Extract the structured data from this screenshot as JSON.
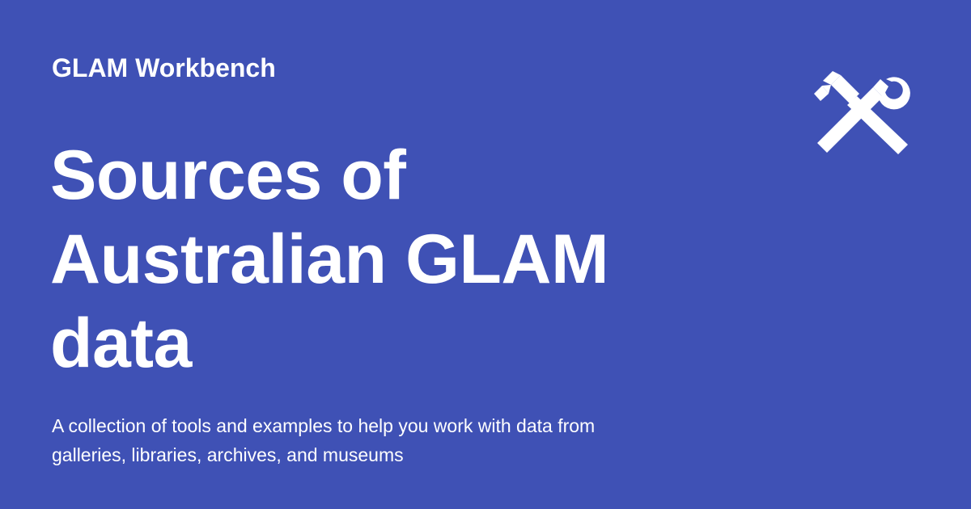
{
  "brand": {
    "site_name": "GLAM Workbench",
    "logo_icon": "hammer-wrench-icon",
    "background_color": "#3f51b5",
    "text_color": "#ffffff"
  },
  "hero": {
    "title_lines": [
      "Sources of",
      "Australian GLAM",
      "data"
    ],
    "description_lines": [
      "A collection of tools and examples to help you work with data from",
      "galleries, libraries, archives, and museums"
    ]
  }
}
